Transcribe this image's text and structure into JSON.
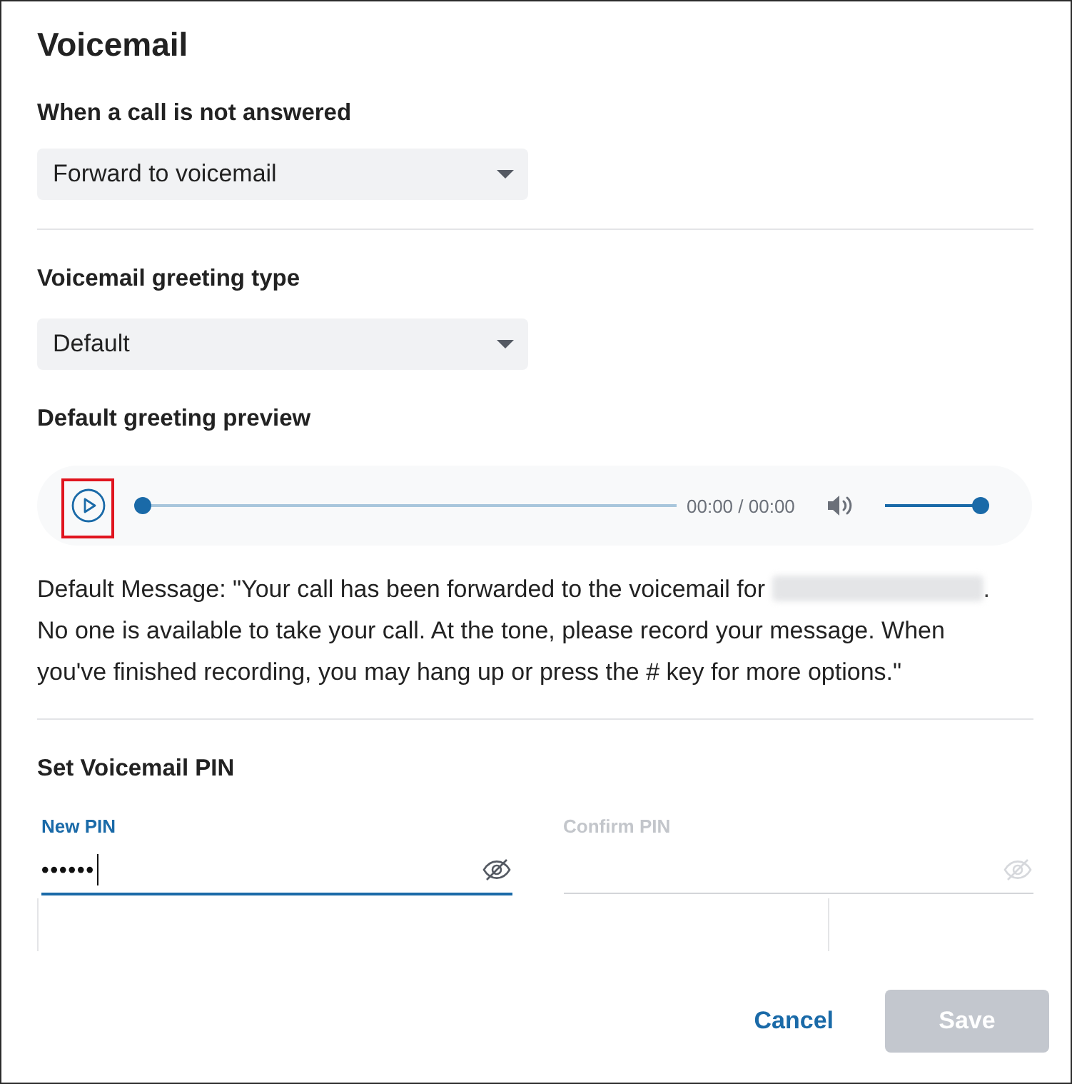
{
  "dialog": {
    "title": "Voicemail"
  },
  "unanswered": {
    "label": "When a call is not answered",
    "value": "Forward to voicemail"
  },
  "greeting_type": {
    "label": "Voicemail greeting type",
    "value": "Default"
  },
  "preview": {
    "label": "Default greeting preview",
    "player": {
      "play_highlighted": true,
      "progress": {
        "level": 0
      },
      "time": "00:00 / 00:00",
      "volume": {
        "level": 1
      }
    },
    "message": {
      "before": "Default Message: \"Your call has been forwarded to the voicemail for ",
      "redacted": true,
      "after": ". No one is available to take your call. At the tone, please record your message. When you've finished recording, you may hang up or press the # key for more options.\""
    }
  },
  "pin": {
    "title": "Set Voicemail PIN",
    "fields": [
      {
        "label": "New PIN",
        "value": "••••••",
        "focused": true,
        "disabled": false,
        "masked": true
      },
      {
        "label": "Confirm PIN",
        "focused": false,
        "disabled": true,
        "masked": true
      }
    ],
    "criteria_open": true
  },
  "buttons": [
    {
      "label": "Cancel",
      "kind": "link",
      "disabled": false
    },
    {
      "label": "Save",
      "kind": "primary",
      "disabled": true
    }
  ]
}
